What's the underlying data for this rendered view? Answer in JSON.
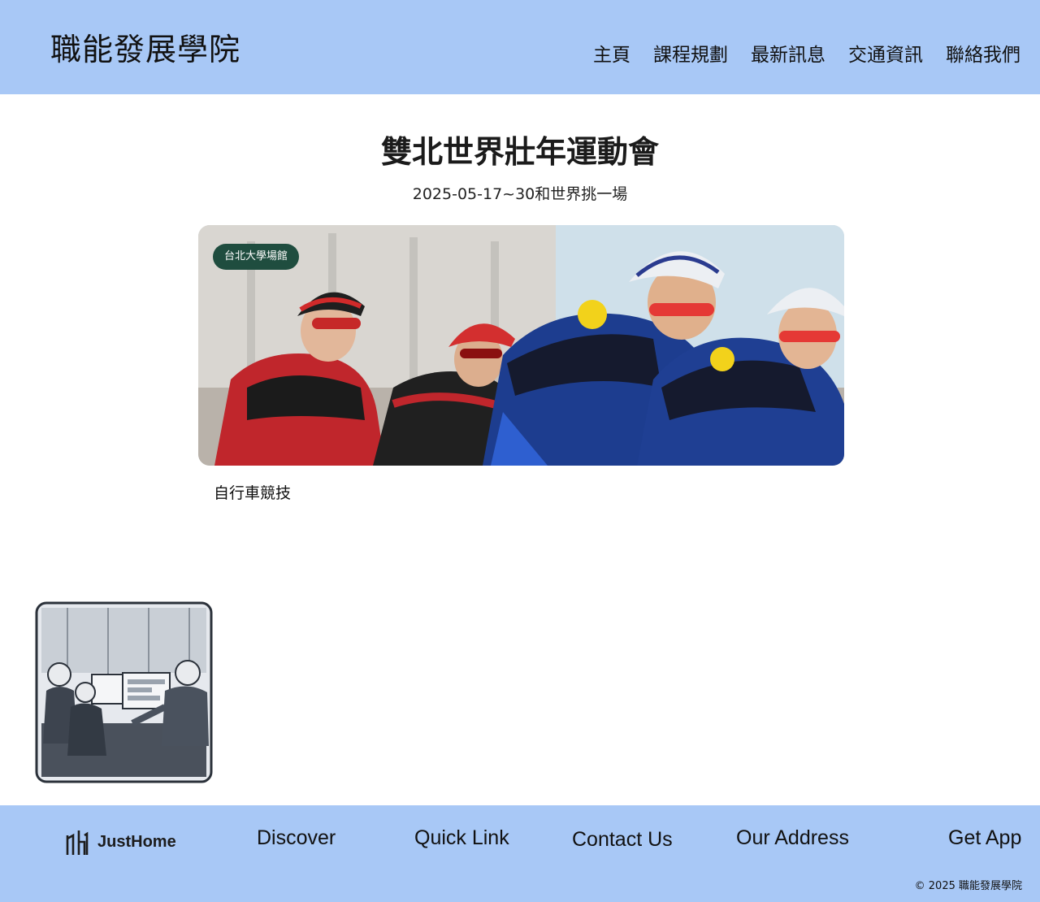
{
  "header": {
    "brand": "職能發展學院",
    "nav": [
      "主頁",
      "課程規劃",
      "最新訊息",
      "交通資訊",
      "聯絡我們"
    ]
  },
  "main": {
    "title": "雙北世界壯年運動會",
    "subtitle": "2025-05-17~30和世界挑一場",
    "card": {
      "badge": "台北大學場館",
      "caption": "自行車競技",
      "photo": "cyclists-racing-photo"
    },
    "illustration": "office-team-computers-sketch"
  },
  "footer": {
    "logo_text": "JustHome",
    "links": [
      "Discover",
      "Quick Link",
      "Contact Us",
      "Our Address",
      "Get App"
    ],
    "copyright": "© 2025 職能發展學院"
  },
  "colors": {
    "header_bg": "#a8c8f6",
    "footer_bg": "#a8c8f6",
    "badge_bg": "#1f4d3f"
  }
}
